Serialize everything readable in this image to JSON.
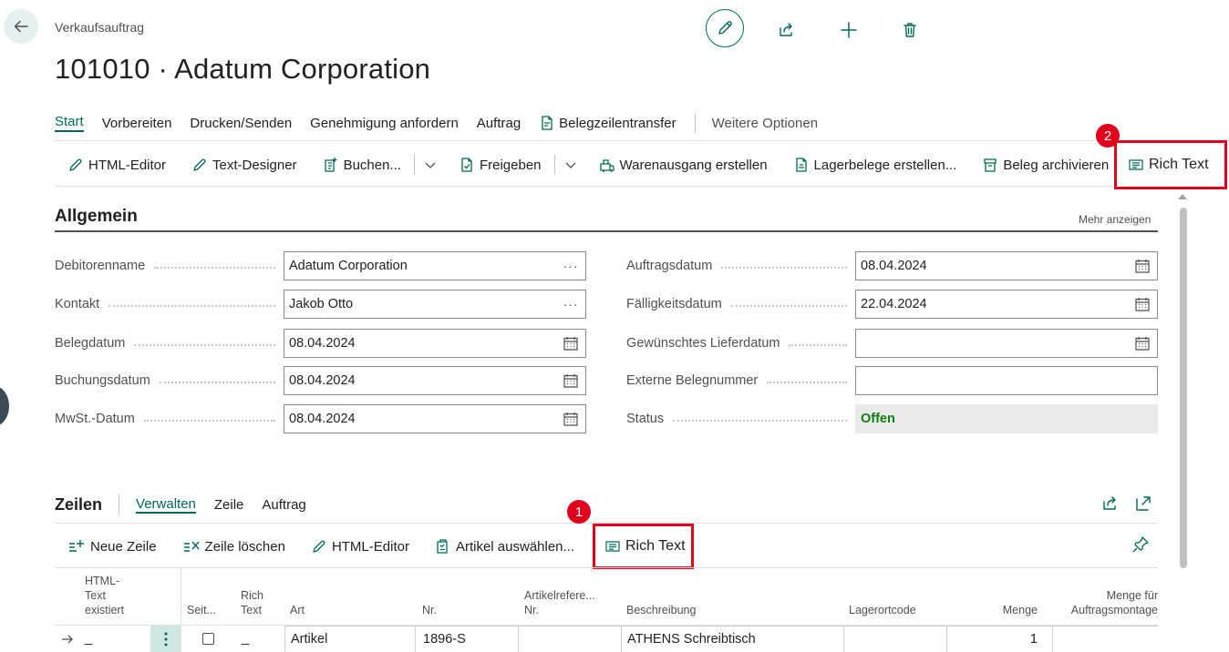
{
  "header": {
    "caption": "Verkaufsauftrag",
    "title": "101010 · Adatum Corporation"
  },
  "action_tabs": {
    "start": "Start",
    "prepare": "Vorbereiten",
    "print_send": "Drucken/Senden",
    "request_approval": "Genehmigung anfordern",
    "order": "Auftrag",
    "line_transfer": "Belegzeilentransfer",
    "more_options": "Weitere Optionen"
  },
  "toolbar": {
    "html_editor": "HTML-Editor",
    "text_designer": "Text-Designer",
    "post": "Buchen...",
    "release": "Freigeben",
    "create_shipment": "Warenausgang erstellen",
    "create_whse_docs": "Lagerbelege erstellen...",
    "archive": "Beleg archivieren",
    "rich_text": "Rich Text"
  },
  "badges": {
    "first": "1",
    "second": "2"
  },
  "general": {
    "title": "Allgemein",
    "show_more": "Mehr anzeigen",
    "customer_name": {
      "label": "Debitorenname",
      "value": "Adatum Corporation"
    },
    "contact": {
      "label": "Kontakt",
      "value": "Jakob Otto"
    },
    "document_date": {
      "label": "Belegdatum",
      "value": "08.04.2024"
    },
    "posting_date": {
      "label": "Buchungsdatum",
      "value": "08.04.2024"
    },
    "vat_date": {
      "label": "MwSt.-Datum",
      "value": "08.04.2024"
    },
    "order_date": {
      "label": "Auftragsdatum",
      "value": "08.04.2024"
    },
    "due_date": {
      "label": "Fälligkeitsdatum",
      "value": "22.04.2024"
    },
    "requested_delivery": {
      "label": "Gewünschtes Lieferdatum",
      "value": ""
    },
    "external_doc_no": {
      "label": "Externe Belegnummer",
      "value": ""
    },
    "status": {
      "label": "Status",
      "value": "Offen"
    },
    "lookup_glyph": "···"
  },
  "lines": {
    "title": "Zeilen",
    "tabs": {
      "manage": "Verwalten",
      "line": "Zeile",
      "order": "Auftrag"
    },
    "toolbar": {
      "new_line": "Neue Zeile",
      "delete_line": "Zeile löschen",
      "html_editor": "HTML-Editor",
      "select_items": "Artikel auswählen...",
      "rich_text": "Rich Text"
    },
    "columns": {
      "html_text_exists": [
        "HTML-",
        "Text",
        "existiert"
      ],
      "page": "Seit...",
      "rich_text": [
        "Rich",
        "Text"
      ],
      "type": "Art",
      "no": "Nr.",
      "item_ref": [
        "Artikelrefere...",
        "Nr."
      ],
      "description": "Beschreibung",
      "location": "Lagerortcode",
      "quantity": "Menge",
      "assembly_qty": [
        "Menge für",
        "Auftragsmontage"
      ]
    },
    "row": {
      "html_text_exists": "_",
      "rich_text": "_",
      "type": "Artikel",
      "no": "1896-S",
      "description": "ATHENS Schreibtisch",
      "quantity": "1"
    }
  },
  "colors": {
    "accent": "#00695c",
    "highlight": "#e0001b",
    "status_open": "#107c10"
  }
}
